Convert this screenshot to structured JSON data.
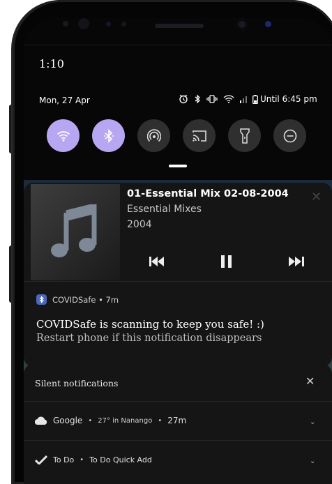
{
  "status": {
    "time": "1:10",
    "date": "Mon, 27 Apr",
    "battery_text": "Until 6:45 pm"
  },
  "quick_settings": [
    {
      "name": "wifi",
      "state": "on"
    },
    {
      "name": "bluetooth",
      "state": "on"
    },
    {
      "name": "hotspot",
      "state": "off"
    },
    {
      "name": "cast",
      "state": "off"
    },
    {
      "name": "flashlight",
      "state": "off"
    },
    {
      "name": "do-not-disturb",
      "state": "off"
    }
  ],
  "media": {
    "title": "01-Essential Mix 02-08-2004",
    "artist": "Essential Mixes",
    "album": "2004",
    "close": "✕"
  },
  "covid_notification": {
    "app_line": "COVIDSafe • 7m",
    "title": "COVIDSafe is scanning to keep you safe! :)",
    "body": "Restart phone if this notification disappears"
  },
  "silent": {
    "header": "Silent notifications",
    "close": "✕",
    "google_app": "Google",
    "google_sep1": "•",
    "google_weather": "27° in Nanango",
    "google_sep2": "•",
    "google_time": "27m",
    "todo_app": "To Do",
    "todo_sep": "•",
    "todo_text": "To Do Quick Add"
  },
  "colors": {
    "toggle_on": "#b7a6f2",
    "toggle_off": "#2f2f2f",
    "card_bg": "#151515"
  }
}
